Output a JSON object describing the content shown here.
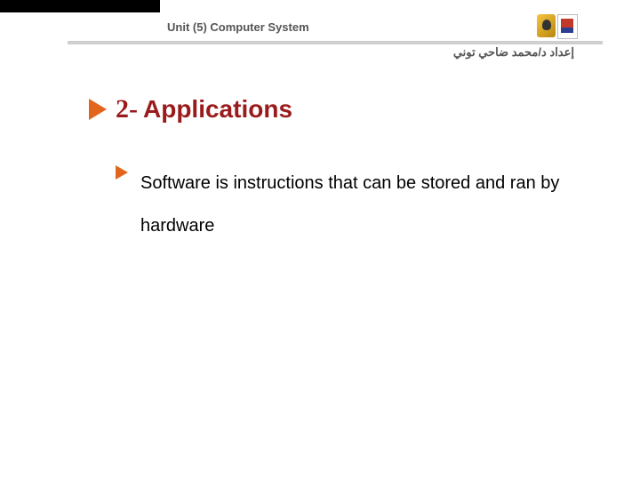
{
  "header": {
    "unit_title": "Unit (5) Computer System",
    "author": "إعداد د/محمد ضاحي توني"
  },
  "section": {
    "number": "2-",
    "title": "Applications"
  },
  "body": {
    "bullet1": "Software is instructions that can be stored and ran by hardware"
  }
}
